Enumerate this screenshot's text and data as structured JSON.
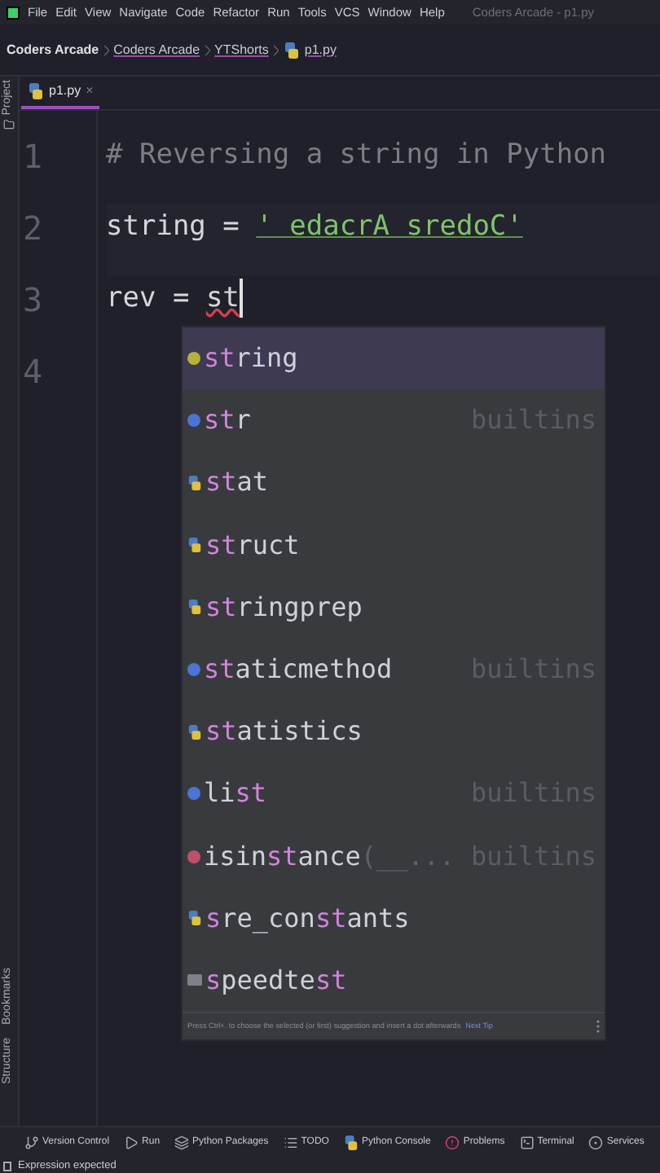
{
  "menu_bar": {
    "items": [
      "File",
      "Edit",
      "View",
      "Navigate",
      "Code",
      "Refactor",
      "Run",
      "Tools",
      "VCS",
      "Window",
      "Help"
    ],
    "title": "Coders Arcade - p1.py"
  },
  "breadcrumbs": [
    {
      "label": "Coders Arcade",
      "kind": "project"
    },
    {
      "label": "Coders Arcade",
      "kind": "folder"
    },
    {
      "label": "YTShorts",
      "kind": "folder"
    },
    {
      "label": "p1.py",
      "kind": "file"
    }
  ],
  "tabs": [
    {
      "label": "p1.py",
      "selected": true,
      "close": "×"
    }
  ],
  "side_tools_top": [
    "Project"
  ],
  "side_tools_bottom": [
    "Bookmarks",
    "Structure"
  ],
  "editor": {
    "lines": [
      {
        "number": "1",
        "tokens": [
          {
            "kind": "comment",
            "text": "# Reversing a string in Python"
          }
        ]
      },
      {
        "number": "2",
        "tokens": [
          {
            "kind": "ident",
            "text": "string"
          },
          {
            "kind": "op",
            "text": " = "
          },
          {
            "kind": "string",
            "text": "' edacrA sredoC'"
          }
        ]
      },
      {
        "number": "3",
        "tokens": [
          {
            "kind": "ident",
            "text": "rev"
          },
          {
            "kind": "op",
            "text": " = "
          },
          {
            "kind": "error",
            "text": "st"
          }
        ],
        "caret": true
      },
      {
        "number": "4"
      }
    ]
  },
  "completion": {
    "items": [
      {
        "kind": "variable",
        "selected": true,
        "parts": [
          {
            "text": "st",
            "match": true
          },
          {
            "text": "ring",
            "match": false
          }
        ]
      },
      {
        "kind": "class",
        "selected": false,
        "parts": [
          {
            "text": "st",
            "match": true
          },
          {
            "text": "r",
            "match": false
          }
        ],
        "source": "builtins"
      },
      {
        "kind": "module",
        "selected": false,
        "parts": [
          {
            "text": "st",
            "match": true
          },
          {
            "text": "at",
            "match": false
          }
        ]
      },
      {
        "kind": "module",
        "selected": false,
        "parts": [
          {
            "text": "st",
            "match": true
          },
          {
            "text": "ruct",
            "match": false
          }
        ]
      },
      {
        "kind": "module",
        "selected": false,
        "parts": [
          {
            "text": "st",
            "match": true
          },
          {
            "text": "ringprep",
            "match": false
          }
        ]
      },
      {
        "kind": "class",
        "selected": false,
        "parts": [
          {
            "text": "st",
            "match": true
          },
          {
            "text": "aticmethod",
            "match": false
          }
        ],
        "source": "builtins"
      },
      {
        "kind": "module",
        "selected": false,
        "parts": [
          {
            "text": "st",
            "match": true
          },
          {
            "text": "atistics",
            "match": false
          }
        ]
      },
      {
        "kind": "class",
        "selected": false,
        "parts": [
          {
            "text": "li",
            "match": false
          },
          {
            "text": "st",
            "match": true
          }
        ],
        "source": "builtins"
      },
      {
        "kind": "function",
        "selected": false,
        "parts": [
          {
            "text": "isin",
            "match": false
          },
          {
            "text": "st",
            "match": true
          },
          {
            "text": "ance",
            "match": false
          },
          {
            "text": "(__...",
            "hint": true
          }
        ],
        "source": "builtins"
      },
      {
        "kind": "module",
        "selected": false,
        "parts": [
          {
            "text": "s",
            "match": true
          },
          {
            "text": "re_con",
            "match": false
          },
          {
            "text": "st",
            "match": true
          },
          {
            "text": "ants",
            "match": false
          }
        ]
      },
      {
        "kind": "package",
        "selected": false,
        "parts": [
          {
            "text": "s",
            "match": true
          },
          {
            "text": "peedte",
            "match": false
          },
          {
            "text": "st",
            "match": true
          }
        ]
      }
    ],
    "tip": "Press Ctrl+. to choose the selected (or first) suggestion and insert a dot afterwards",
    "tip_link": "Next Tip"
  },
  "bottom_tools": [
    {
      "label": "Version Control"
    },
    {
      "label": "Run"
    },
    {
      "label": "Python Packages"
    },
    {
      "label": "TODO"
    },
    {
      "label": "Python Console"
    },
    {
      "label": "Problems"
    },
    {
      "label": "Terminal"
    },
    {
      "label": "Services"
    }
  ],
  "status_bar": {
    "message": "Expression expected"
  }
}
